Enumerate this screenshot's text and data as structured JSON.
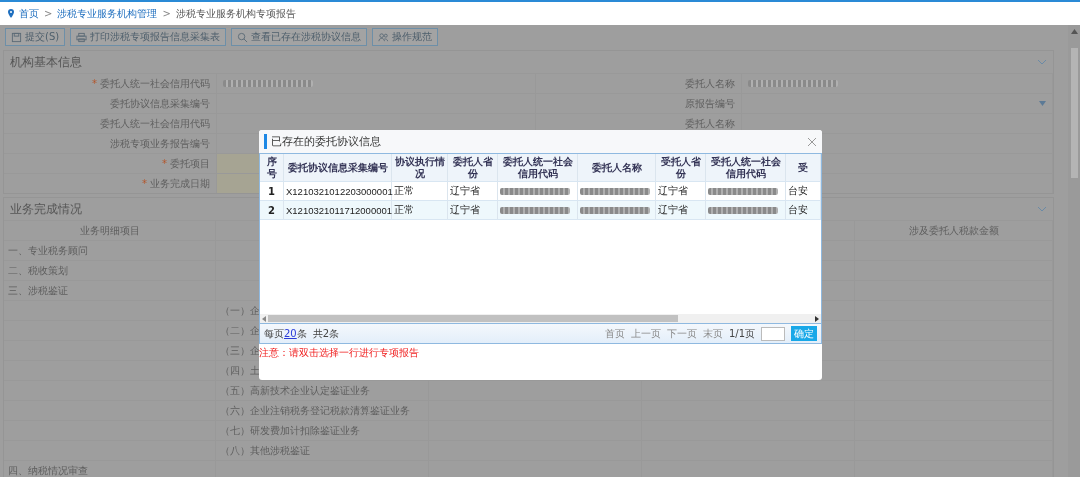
{
  "breadcrumb": {
    "separator": ">",
    "items": [
      "首页",
      "涉税专业服务机构管理",
      "涉税专业服务机构专项报告"
    ]
  },
  "toolbar": [
    {
      "kind": "save",
      "label": "提交(S)"
    },
    {
      "kind": "print",
      "label": "打印涉税专项报告信息采集表"
    },
    {
      "kind": "search",
      "label": "查看已存在涉税协议信息"
    },
    {
      "kind": "users",
      "label": "操作规范"
    }
  ],
  "basic_info": {
    "title": "机构基本信息",
    "required_mark": "*",
    "rows": [
      {
        "label": "委托人统一社会信用代码",
        "required": true,
        "value": {
          "kind": "redacted"
        },
        "right": {
          "label": "委托人名称",
          "kind": "redacted"
        }
      },
      {
        "label": "委托协议信息采集编号",
        "required": false,
        "value": {
          "kind": "empty"
        },
        "right": {
          "label": "原报告编号",
          "kind": "dropdown"
        }
      },
      {
        "label": "委托人统一社会信用代码",
        "required": false,
        "value": {
          "kind": "empty"
        },
        "right": {
          "label": "委托人名称",
          "kind": "empty"
        }
      },
      {
        "label": "涉税专项业务报告编号",
        "required": false,
        "value": {
          "kind": "empty"
        }
      },
      {
        "label": "委托项目",
        "required": true,
        "value": {
          "kind": "highlight"
        }
      },
      {
        "label": "业务完成日期",
        "required": true,
        "value": {
          "kind": "highlight"
        }
      }
    ]
  },
  "completion": {
    "title": "业务完成情况",
    "columns": [
      "业务明细项目",
      "涉及委托人税款金额"
    ],
    "rows": [
      {
        "kind": "main",
        "label": "一、专业税务顾问"
      },
      {
        "kind": "main",
        "label": "二、税收策划"
      },
      {
        "kind": "main",
        "label": "三、涉税鉴证"
      },
      {
        "kind": "sub",
        "label": "（一）企"
      },
      {
        "kind": "sub",
        "label": "（二）企"
      },
      {
        "kind": "sub",
        "label": "（三）企"
      },
      {
        "kind": "sub",
        "label": "（四）土"
      },
      {
        "kind": "sub",
        "label": "（五）高新技术企业认定鉴证业务"
      },
      {
        "kind": "sub",
        "label": "（六）企业注销税务登记税款清算鉴证业务"
      },
      {
        "kind": "sub",
        "label": "（七）研发费加计扣除鉴证业务"
      },
      {
        "kind": "sub",
        "label": "（八）其他涉税鉴证"
      },
      {
        "kind": "main",
        "label": "四、纳税情况审查"
      }
    ]
  },
  "dialog": {
    "title": "已存在的委托协议信息",
    "columns": [
      "序号",
      "委托协议信息采集编号",
      "协议执行情况",
      "委托人省份",
      "委托人统一社会信用代码",
      "委托人名称",
      "受托人省份",
      "受托人统一社会信用代码",
      "受"
    ],
    "rows": [
      {
        "index": "1",
        "number": "X1210321012203000001",
        "status": "正常",
        "province": "辽宁省",
        "agent_province": "辽宁省",
        "column_9": "台安"
      },
      {
        "index": "2",
        "number": "X1210321011712000001",
        "status": "正常",
        "province": "辽宁省",
        "agent_province": "辽宁省",
        "column_9": "台安"
      }
    ],
    "pager": {
      "per_page_prefix": "每页",
      "per_page": "20",
      "per_page_suffix": "条",
      "total": "共2条",
      "first": "首页",
      "prev": "上一页",
      "next": "下一页",
      "last": "末页",
      "page": "1/1页",
      "go": "确定"
    },
    "note": "注意：请双击选择一行进行专项报告"
  }
}
